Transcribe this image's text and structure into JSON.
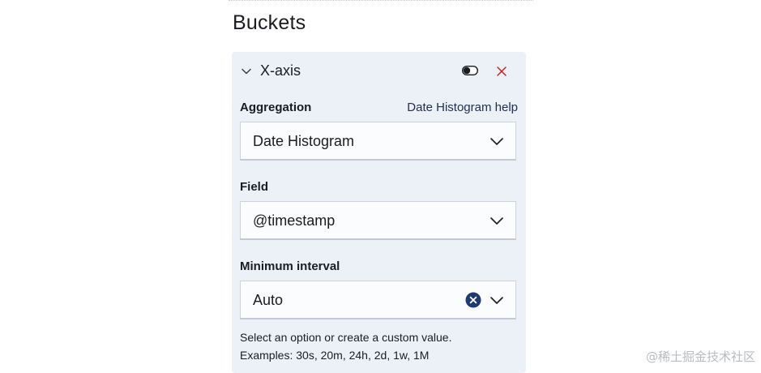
{
  "section": {
    "title": "Buckets"
  },
  "axis_panel": {
    "title": "X-axis",
    "aggregation": {
      "label": "Aggregation",
      "help_link": "Date Histogram help",
      "value": "Date Histogram"
    },
    "field": {
      "label": "Field",
      "value": "@timestamp"
    },
    "interval": {
      "label": "Minimum interval",
      "value": "Auto",
      "help_line1": "Select an option or create a custom value.",
      "help_line2": "Examples: 30s, 20m, 24h, 2d, 1w, 1M"
    },
    "icons": {
      "collapse": "chevron-down-icon",
      "toggle": "toggle-icon",
      "remove": "close-icon",
      "clear": "clear-icon"
    },
    "colors": {
      "panel_bg": "#ecf1f8",
      "remove_accent": "#bd271e",
      "clear_badge": "#343741"
    }
  },
  "watermark": "@稀土掘金技术社区"
}
